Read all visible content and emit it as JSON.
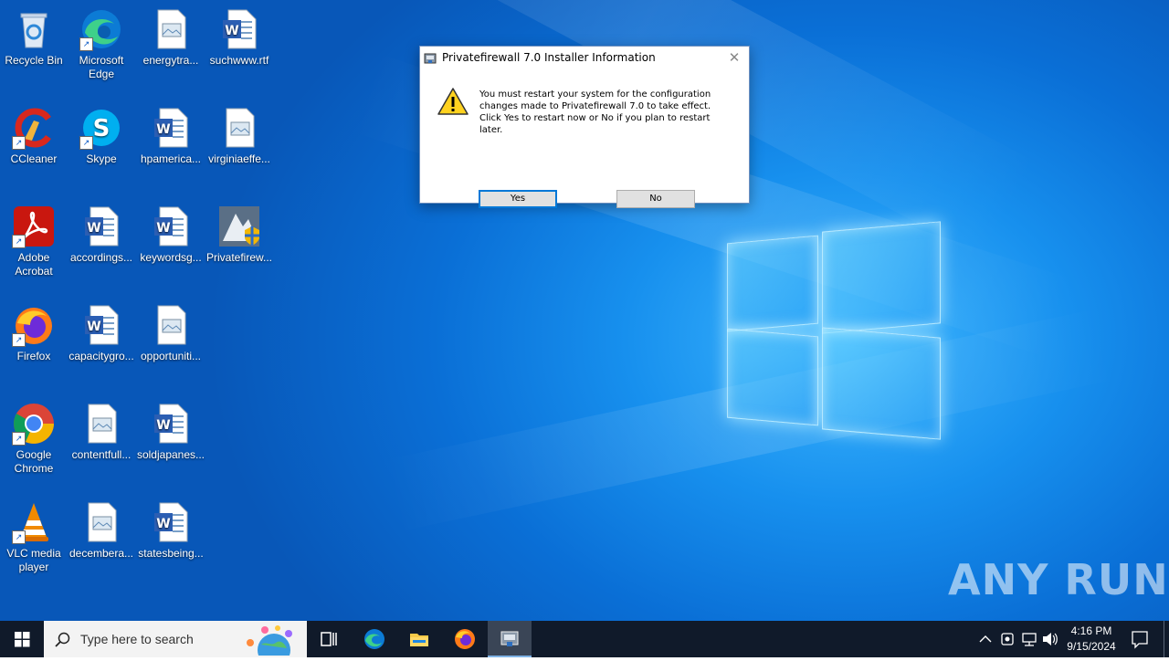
{
  "desktop": {
    "icons": [
      {
        "label": "Recycle Bin"
      },
      {
        "label": "Microsoft Edge"
      },
      {
        "label": "energytra..."
      },
      {
        "label": "suchwww.rtf"
      },
      {
        "label": "CCleaner"
      },
      {
        "label": "Skype"
      },
      {
        "label": "hpamerica..."
      },
      {
        "label": "virginiaeffe..."
      },
      {
        "label": "Adobe Acrobat"
      },
      {
        "label": "accordings..."
      },
      {
        "label": "keywordsg..."
      },
      {
        "label": "Privatefirew..."
      },
      {
        "label": "Firefox"
      },
      {
        "label": "capacitygro..."
      },
      {
        "label": "opportuniti..."
      },
      {
        "label": "Google Chrome"
      },
      {
        "label": "contentfull..."
      },
      {
        "label": "soldjapanes..."
      },
      {
        "label": "VLC media player"
      },
      {
        "label": "decembera..."
      },
      {
        "label": "statesbeing..."
      }
    ],
    "watermark": "ANY RUN"
  },
  "dialog": {
    "title": "Privatefirewall 7.0 Installer Information",
    "close_glyph": "✕",
    "message": "You must restart your system for the configuration changes made to Privatefirewall 7.0 to take effect. Click Yes to restart now or No if you plan to restart later.",
    "yes_label": "Yes",
    "no_label": "No"
  },
  "taskbar": {
    "search_placeholder": "Type here to search",
    "clock_time": "4:16 PM",
    "clock_date": "9/15/2024",
    "pinned": [
      "task-view-icon",
      "edge-icon",
      "file-explorer-icon",
      "firefox-icon",
      "installer-icon"
    ],
    "accent": "#0078d7"
  }
}
